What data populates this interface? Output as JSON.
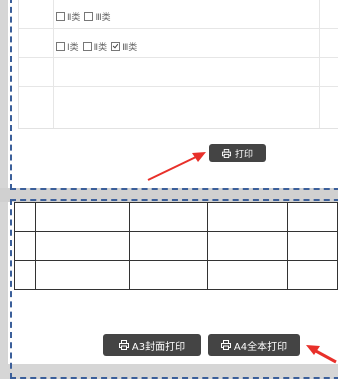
{
  "options": {
    "line1": [
      {
        "label": "Ⅱ类",
        "checked": false
      },
      {
        "label": "Ⅲ类",
        "checked": false
      }
    ],
    "line2": [
      {
        "label": "Ⅰ类",
        "checked": false
      },
      {
        "label": "Ⅱ类",
        "checked": false
      },
      {
        "label": "Ⅲ类",
        "checked": true
      }
    ]
  },
  "buttons": {
    "print": "打印",
    "a3_cover_print": "A3封面打印",
    "a4_full_print": "A4全本打印"
  },
  "table": {
    "rows": 3,
    "cols": 5
  },
  "colors": {
    "button_bg": "#444444",
    "dash": "#3b5f9a",
    "arrow": "#e8302a"
  }
}
